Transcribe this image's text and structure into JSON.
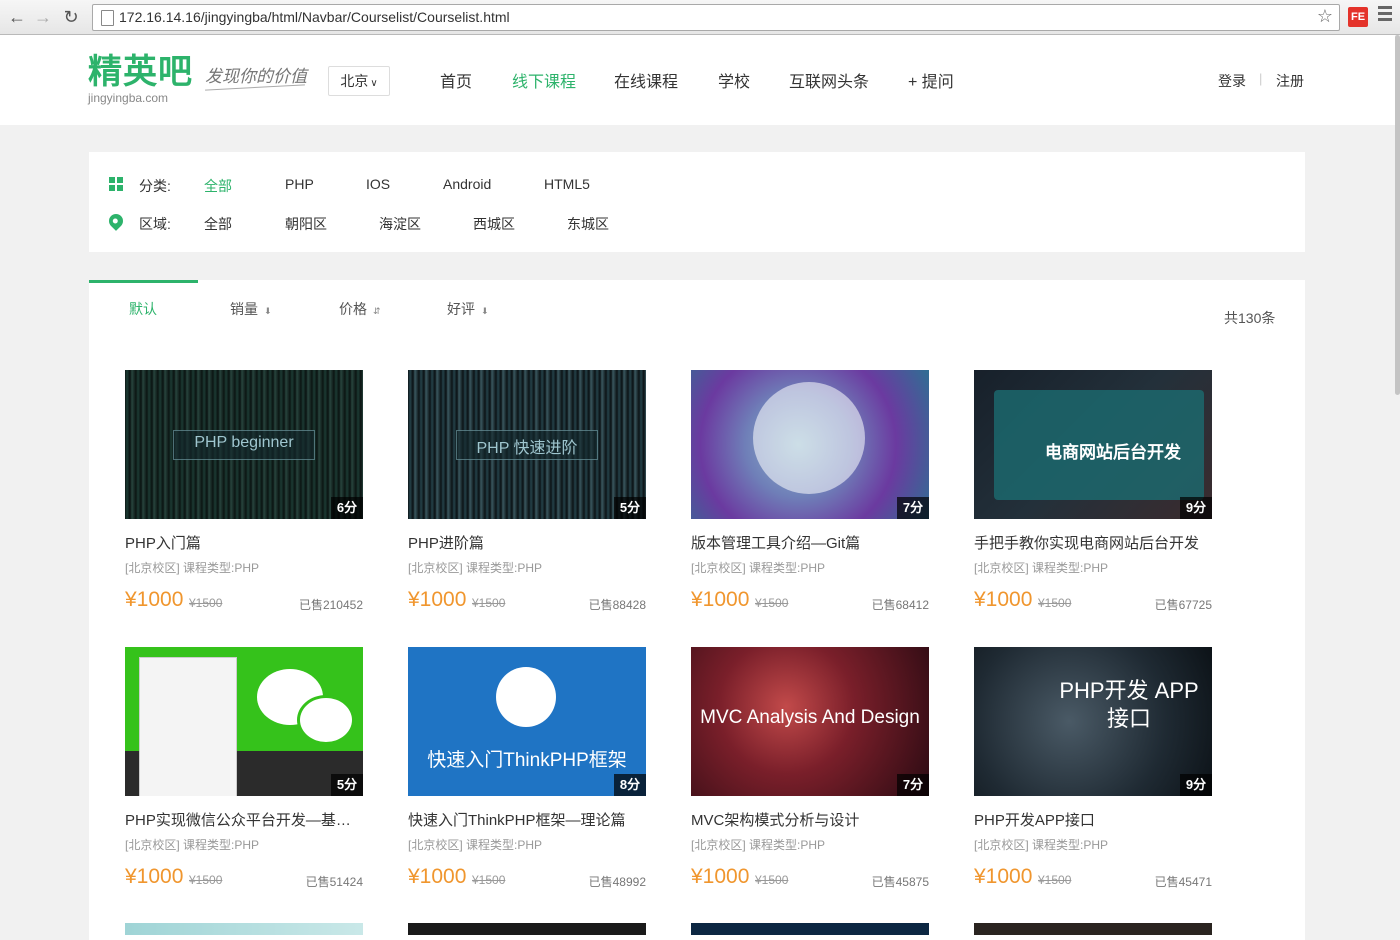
{
  "browser": {
    "url": "172.16.14.16/jingyingba/html/Navbar/Courselist/Courselist.html",
    "ext_label": "FE"
  },
  "header": {
    "logo_main": "精英吧",
    "logo_sub": "jingyingba.com",
    "slogan": "发现你的价值",
    "city": "北京",
    "nav": [
      {
        "label": "首页"
      },
      {
        "label": "线下课程"
      },
      {
        "label": "在线课程"
      },
      {
        "label": "学校"
      },
      {
        "label": "互联网头条"
      },
      {
        "label": "+ 提问"
      }
    ],
    "login": "登录",
    "register": "注册",
    "separator": "|"
  },
  "filters": {
    "category_label": "分类:",
    "category_options": [
      "全部",
      "PHP",
      "IOS",
      "Android",
      "HTML5"
    ],
    "area_label": "区域:",
    "area_options": [
      "全部",
      "朝阳区",
      "海淀区",
      "西城区",
      "东城区"
    ]
  },
  "sort": {
    "tabs": [
      "默认",
      "销量",
      "价格",
      "好评"
    ],
    "total": "共130条"
  },
  "courses": [
    {
      "title": "PHP入门篇",
      "meta": "[北京校区] 课程类型:PHP",
      "price": "¥1000",
      "old_price": "¥1500",
      "sold": "已售210452",
      "score": "6分",
      "thumb_text": "PHP beginner"
    },
    {
      "title": "PHP进阶篇",
      "meta": "[北京校区] 课程类型:PHP",
      "price": "¥1000",
      "old_price": "¥1500",
      "sold": "已售88428",
      "score": "5分",
      "thumb_text": "PHP 快速进阶"
    },
    {
      "title": "版本管理工具介绍—Git篇",
      "meta": "[北京校区] 课程类型:PHP",
      "price": "¥1000",
      "old_price": "¥1500",
      "sold": "已售68412",
      "score": "7分",
      "thumb_text": ""
    },
    {
      "title": "手把手教你实现电商网站后台开发",
      "meta": "[北京校区] 课程类型:PHP",
      "price": "¥1000",
      "old_price": "¥1500",
      "sold": "已售67725",
      "score": "9分",
      "thumb_text": "电商网站后台开发"
    },
    {
      "title": "PHP实现微信公众平台开发—基础篇",
      "meta": "[北京校区] 课程类型:PHP",
      "price": "¥1000",
      "old_price": "¥1500",
      "sold": "已售51424",
      "score": "5分",
      "thumb_text": ""
    },
    {
      "title": "快速入门ThinkPHP框架—理论篇",
      "meta": "[北京校区] 课程类型:PHP",
      "price": "¥1000",
      "old_price": "¥1500",
      "sold": "已售48992",
      "score": "8分",
      "thumb_text": "快速入门ThinkPHP框架"
    },
    {
      "title": "MVC架构模式分析与设计",
      "meta": "[北京校区] 课程类型:PHP",
      "price": "¥1000",
      "old_price": "¥1500",
      "sold": "已售45875",
      "score": "7分",
      "thumb_text": "MVC Analysis And Design"
    },
    {
      "title": "PHP开发APP接口",
      "meta": "[北京校区] 课程类型:PHP",
      "price": "¥1000",
      "old_price": "¥1500",
      "sold": "已售45471",
      "score": "9分",
      "thumb_text": "PHP开发 APP接口"
    }
  ],
  "colors": {
    "accent": "#2db36b",
    "price": "#f0962e",
    "page_bg": "#f1f1f1"
  }
}
